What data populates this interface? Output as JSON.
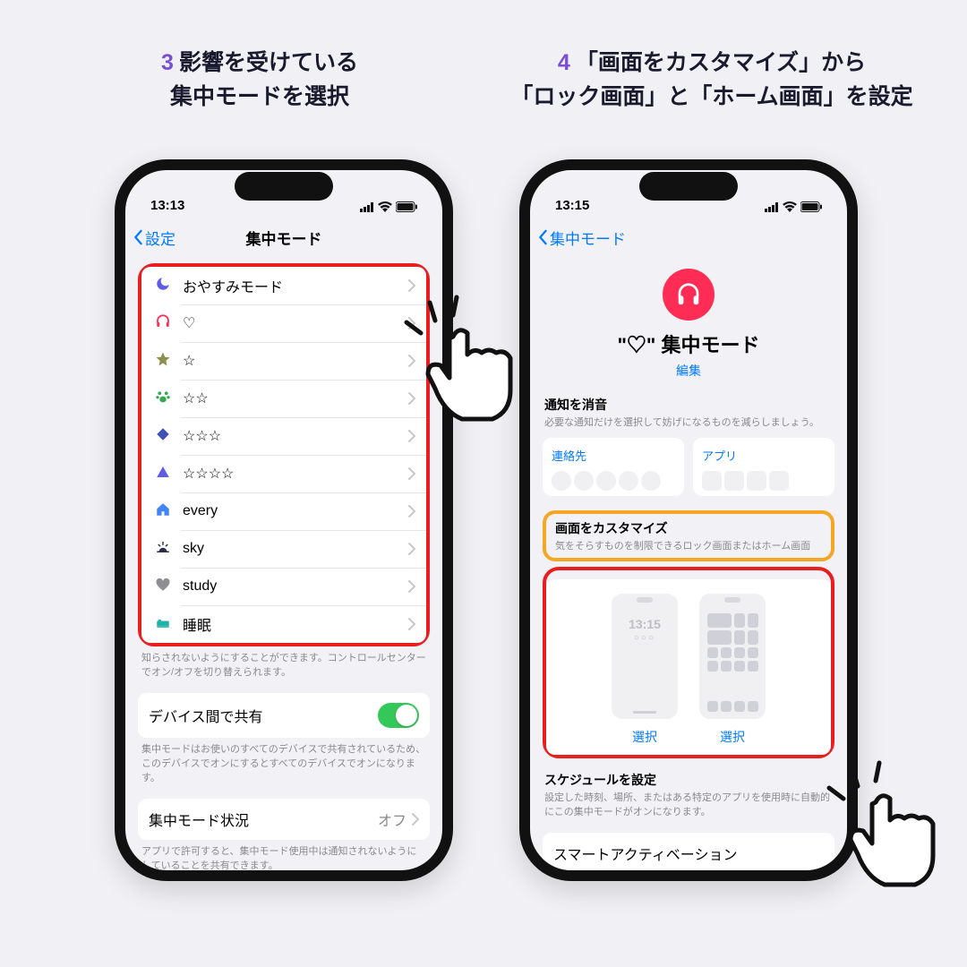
{
  "step3": {
    "num": "3",
    "line1": "影響を受けている",
    "line2": "集中モードを選択"
  },
  "step4": {
    "num": "4",
    "line1": "「画面をカスタマイズ」から",
    "line2": "「ロック画面」と「ホーム画面」を設定"
  },
  "left": {
    "status": {
      "time": "13:13"
    },
    "nav": {
      "back": "設定",
      "title": "集中モード"
    },
    "modes": [
      {
        "icon": "moon",
        "label": "おやすみモード",
        "iconColor": "#5e5ce6"
      },
      {
        "icon": "headphones",
        "label": "♡",
        "iconColor": "#ff2d55"
      },
      {
        "icon": "star",
        "label": "☆",
        "iconColor": "#8e8e4d"
      },
      {
        "icon": "paw",
        "label": "☆☆",
        "iconColor": "#34a853"
      },
      {
        "icon": "diamond",
        "label": "☆☆☆",
        "iconColor": "#3f51b5"
      },
      {
        "icon": "triangle",
        "label": "☆☆☆☆",
        "iconColor": "#5e5ce6"
      },
      {
        "icon": "home",
        "label": "every",
        "iconColor": "#4285f4"
      },
      {
        "icon": "sunrise",
        "label": "sky",
        "iconColor": "#2d2d4a"
      },
      {
        "icon": "heart",
        "label": "study",
        "iconColor": "#8e8e93"
      },
      {
        "icon": "bed",
        "label": "睡眠",
        "iconColor": "#20b2aa"
      }
    ],
    "help1": "知らされないようにすることができます。コントロールセンターでオン/オフを切り替えられます。",
    "share": {
      "label": "デバイス間で共有"
    },
    "share_help": "集中モードはお使いのすべてのデバイスで共有されているため、このデバイスでオンにするとすべてのデバイスでオンになります。",
    "status_row": {
      "label": "集中モード状況",
      "value": "オフ"
    },
    "status_help": "アプリで許可すると、集中モード使用中は通知されないようにしていることを共有できます。"
  },
  "right": {
    "status": {
      "time": "13:15"
    },
    "nav": {
      "back": "集中モード"
    },
    "title": "\"♡\" 集中モード",
    "edit": "編集",
    "notify": {
      "title": "通知を消音",
      "sub": "必要な通知だけを選択して妨げになるものを減らしましょう。"
    },
    "contacts": "連絡先",
    "apps": "アプリ",
    "customize": {
      "title": "画面をカスタマイズ",
      "sub": "気をそらすものを制限できるロック画面またはホーム画面"
    },
    "lock_preview_time": "13:15",
    "select": "選択",
    "schedule": {
      "title": "スケジュールを設定",
      "sub": "設定した時刻、場所、またはある特定のアプリを使用時に自動的にこの集中モードがオンになります。"
    },
    "smart": "スマートアクティベーション"
  }
}
